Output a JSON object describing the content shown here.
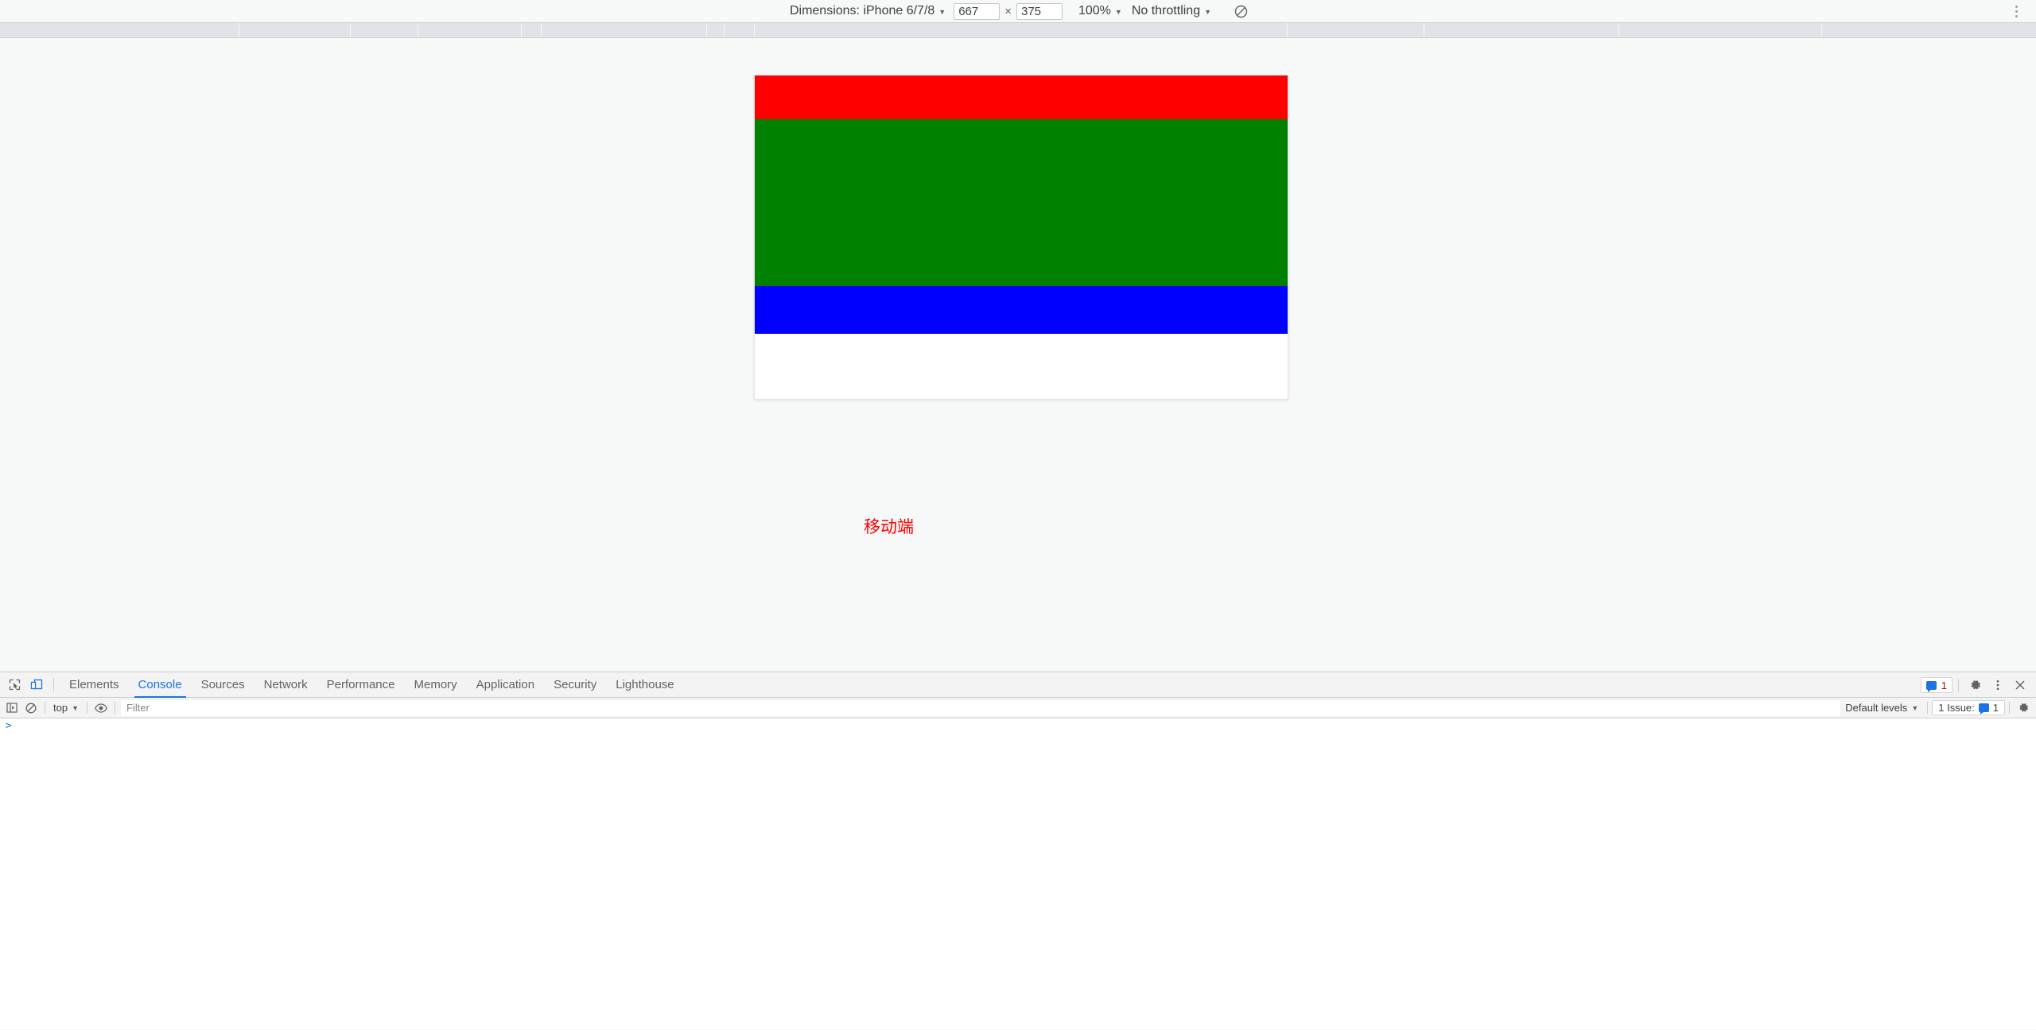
{
  "device_toolbar": {
    "dimensions_label": "Dimensions: iPhone 6/7/8",
    "width_value": "667",
    "height_value": "375",
    "multiply_symbol": "×",
    "zoom_value": "100%",
    "throttling_value": "No throttling",
    "rotate_icon": "rotate-icon",
    "more_options_icon": "kebab-menu-icon"
  },
  "viewport": {
    "bars": [
      {
        "name": "red-bar",
        "color": "#FF0000"
      },
      {
        "name": "green-bar",
        "color": "#008000"
      },
      {
        "name": "blue-bar",
        "color": "#0000FF"
      }
    ],
    "caption": {
      "text": "移动端",
      "color": "#FF0000"
    }
  },
  "devtools": {
    "inspect_icon": "inspect-element-icon",
    "device_toggle_icon": "device-toolbar-icon",
    "tabs": [
      {
        "label": "Elements",
        "active": false
      },
      {
        "label": "Console",
        "active": true
      },
      {
        "label": "Sources",
        "active": false
      },
      {
        "label": "Network",
        "active": false
      },
      {
        "label": "Performance",
        "active": false
      },
      {
        "label": "Memory",
        "active": false
      },
      {
        "label": "Application",
        "active": false
      },
      {
        "label": "Security",
        "active": false
      },
      {
        "label": "Lighthouse",
        "active": false
      }
    ],
    "tabbar_right": {
      "message_count": "1",
      "settings_icon": "gear-icon",
      "more_icon": "kebab-menu-icon",
      "close_icon": "close-icon"
    },
    "console_toolbar": {
      "sidebar_icon": "console-sidebar-icon",
      "clear_icon": "clear-console-icon",
      "context_value": "top",
      "eye_icon": "live-expression-icon",
      "filter_placeholder": "Filter",
      "filter_value": "",
      "levels_value": "Default levels",
      "issues_label": "1 Issue:",
      "issues_count": "1",
      "settings_icon": "gear-icon"
    },
    "console_body": {
      "prompt_symbol": ">"
    }
  },
  "colors": {
    "accent": "#1a73e8",
    "toolbar_bg": "#f3f3f3",
    "page_bg": "#f7f8f8",
    "ruler_bg": "#e1e3e6"
  }
}
